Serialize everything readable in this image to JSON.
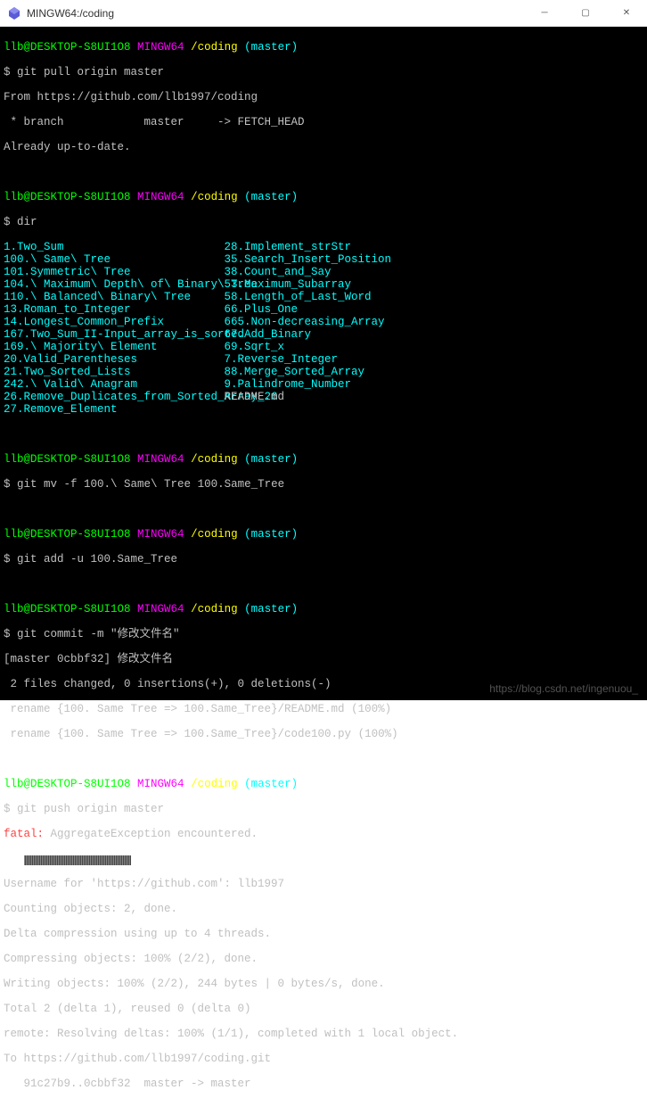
{
  "window": {
    "title": "MINGW64:/coding"
  },
  "prompt": {
    "user_host": "llb@DESKTOP-S8UI1O8",
    "env": "MINGW64",
    "path": "/coding",
    "branch": "(master)",
    "ps": "$"
  },
  "block1": {
    "cmd": "git pull origin master",
    "l1": "From https://github.com/llb1997/coding",
    "l2": " * branch            master     -> FETCH_HEAD",
    "l3": "Already up-to-date."
  },
  "block2": {
    "cmd": "dir",
    "rows": [
      [
        "1.Two_Sum",
        "28.Implement_strStr"
      ],
      [
        "100.\\ Same\\ Tree",
        "35.Search_Insert_Position"
      ],
      [
        "101.Symmetric\\ Tree",
        "38.Count_and_Say"
      ],
      [
        "104.\\ Maximum\\ Depth\\ of\\ Binary\\ Tree",
        "53.Maximum_Subarray"
      ],
      [
        "110.\\ Balanced\\ Binary\\ Tree",
        "58.Length_of_Last_Word"
      ],
      [
        "13.Roman_to_Integer",
        "66.Plus_One"
      ],
      [
        "14.Longest_Common_Prefix",
        "665.Non-decreasing_Array"
      ],
      [
        "167.Two_Sum_II-Input_array_is_sorted",
        "67.Add_Binary"
      ],
      [
        "169.\\ Majority\\ Element",
        "69.Sqrt_x"
      ],
      [
        "20.Valid_Parentheses",
        "7.Reverse_Integer"
      ],
      [
        "21.Two_Sorted_Lists",
        "88.Merge_Sorted_Array"
      ],
      [
        "242.\\ Valid\\ Anagram",
        "9.Palindrome_Number"
      ],
      [
        "26.Remove_Duplicates_from_Sorted_Array_26",
        "README.md"
      ],
      [
        "27.Remove_Element",
        ""
      ]
    ]
  },
  "block3": {
    "cmd": "git mv -f 100.\\ Same\\ Tree 100.Same_Tree"
  },
  "block4": {
    "cmd": "git add -u 100.Same_Tree"
  },
  "block5": {
    "cmd": "git commit -m \"修改文件名\"",
    "l1": "[master 0cbbf32] 修改文件名",
    "l2": " 2 files changed, 0 insertions(+), 0 deletions(-)",
    "l3": " rename {100. Same Tree => 100.Same_Tree}/README.md (100%)",
    "l4": " rename {100. Same Tree => 100.Same_Tree}/code100.py (100%)"
  },
  "block6": {
    "cmd": "git push origin master",
    "err_pre": "fatal: ",
    "err": "AggregateException encountered.",
    "l2": "Username for 'https://github.com': llb1997",
    "l3": "Counting objects: 2, done.",
    "l4": "Delta compression using up to 4 threads.",
    "l5": "Compressing objects: 100% (2/2), done.",
    "l6": "Writing objects: 100% (2/2), 244 bytes | 0 bytes/s, done.",
    "l7": "Total 2 (delta 1), reused 0 (delta 0)",
    "l8": "remote: Resolving deltas: 100% (1/1), completed with 1 local object.",
    "l9": "To https://github.com/llb1997/coding.git",
    "l10": "   91c27b9..0cbbf32  master -> master"
  },
  "watermark": "https://blog.csdn.net/ingenuou_"
}
